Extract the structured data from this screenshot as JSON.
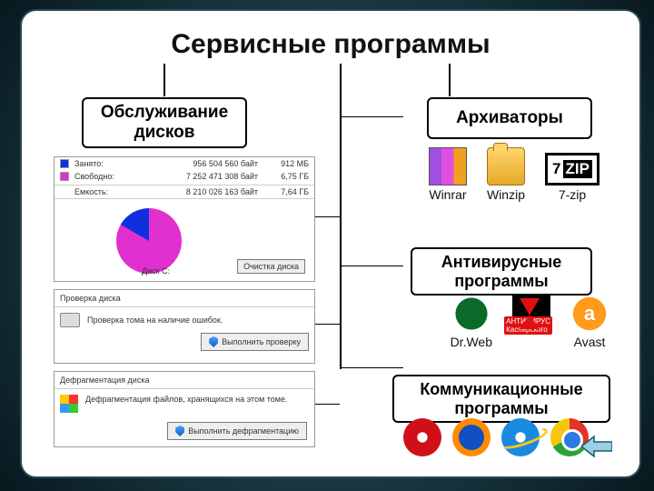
{
  "title": "Сервисные программы",
  "categories": {
    "disks": "Обслуживание дисков",
    "arch": "Архиваторы",
    "av": "Антивирусные программы",
    "comm": "Коммуникационные программы"
  },
  "disk_panel": {
    "busy_label": "Занято:",
    "busy_bytes": "956 504 560 байт",
    "busy_h": "912 МБ",
    "free_label": "Свободно:",
    "free_bytes": "7 252 471 308 байт",
    "free_h": "6,75 ГБ",
    "cap_label": "Емкость:",
    "cap_bytes": "8 210 026 163 байт",
    "cap_h": "7,64 ГБ",
    "chart_label": "Диск С:",
    "cleanup_btn": "Очистка диска"
  },
  "check_panel": {
    "title": "Проверка диска",
    "desc": "Проверка тома на наличие ошибок.",
    "btn": "Выполнить проверку"
  },
  "defrag_panel": {
    "title": "Дефрагментация диска",
    "desc": "Дефрагментация файлов, хранящихся на этом томе.",
    "btn": "Выполнить дефрагментацию"
  },
  "arch_apps": {
    "winrar": "Winrar",
    "winzip": "Winzip",
    "zip7": "7-zip"
  },
  "av_apps": {
    "drweb": "Dr.Web",
    "kasper_badge": "АНТИВИРУС Касперского",
    "avast": "Avast"
  },
  "chart_data": {
    "type": "pie",
    "title": "Диск С:",
    "series": [
      {
        "name": "Занято",
        "value_bytes": 956504560,
        "value_h": "912 МБ",
        "color": "#1030e0"
      },
      {
        "name": "Свободно",
        "value_bytes": 7252471308,
        "value_h": "6,75 ГБ",
        "color": "#e030d0"
      }
    ],
    "total": {
      "name": "Емкость",
      "value_bytes": 8210026163,
      "value_h": "7,64 ГБ"
    }
  }
}
